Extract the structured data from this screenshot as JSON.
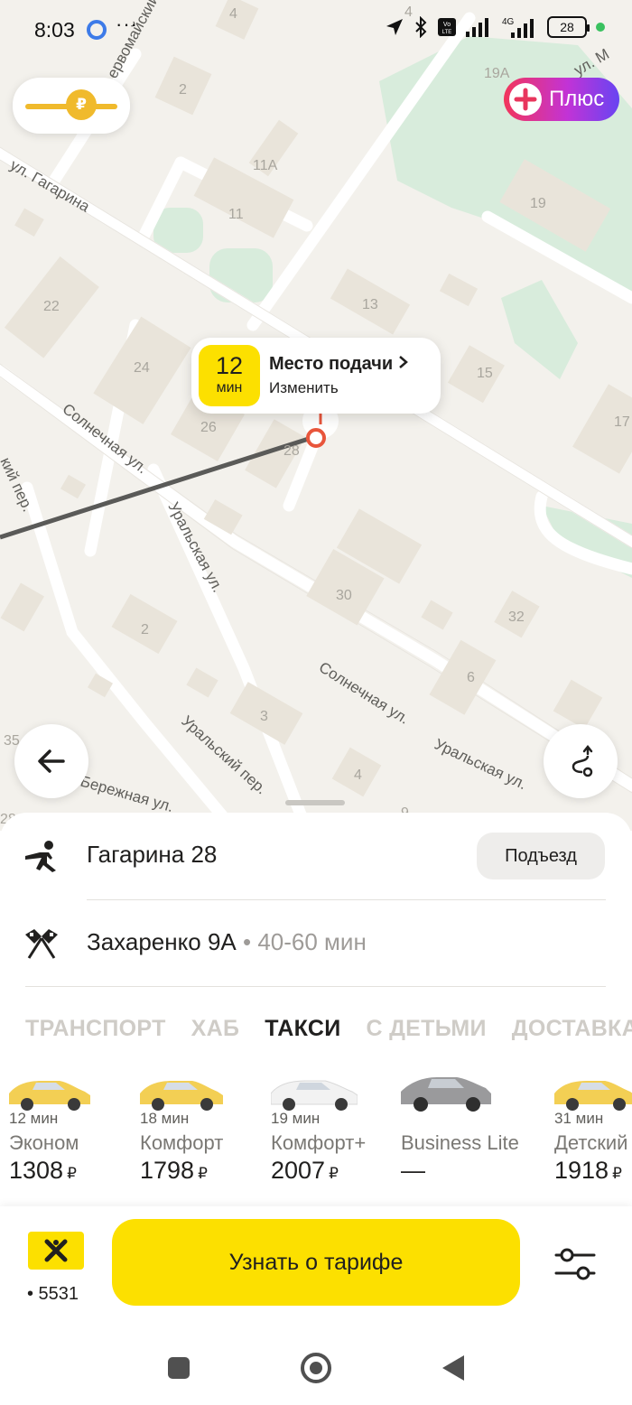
{
  "status_bar": {
    "time": "8:03",
    "more": "···",
    "battery": "28",
    "volte_label": "Vo LTE",
    "net_label": "4G"
  },
  "map": {
    "streets": [
      "ул. Гагарина",
      "Солнечная ул.",
      "Уральская ул.",
      "Солнечная ул.",
      "Уральская ул.",
      "Уральский пер.",
      "Бережная ул.",
      "кий пер.",
      "ервомайский",
      "ул. М"
    ],
    "house_numbers": [
      "4",
      "4",
      "2",
      "19А",
      "11А",
      "11",
      "19",
      "22",
      "13",
      "24",
      "15",
      "17",
      "26",
      "28",
      "30",
      "2",
      "32",
      "6",
      "3",
      "35",
      "4",
      "28",
      "9"
    ]
  },
  "surge": {
    "icon": "ruble-lightning-icon"
  },
  "plus": {
    "label": "Плюс"
  },
  "pickup_bubble": {
    "eta_value": "12",
    "eta_unit": "мин",
    "title": "Место подачи",
    "subtitle": "Изменить"
  },
  "route": {
    "from": "Гагарина 28",
    "entrance_button": "Подъезд",
    "to": "Захаренко 9А",
    "eta_separator": " • ",
    "eta": "40-60 мин"
  },
  "tabs": [
    {
      "label": "ТРАНСПОРТ",
      "active": false
    },
    {
      "label": "ХАБ",
      "active": false
    },
    {
      "label": "ТАКСИ",
      "active": true
    },
    {
      "label": "С ДЕТЬМИ",
      "active": false
    },
    {
      "label": "ДОСТАВКА",
      "active": false
    }
  ],
  "tariffs": [
    {
      "time": "12 мин",
      "name": "Эконом",
      "price": "1308",
      "currency": "₽",
      "car_color": "#f3cf54"
    },
    {
      "time": "18 мин",
      "name": "Комфорт",
      "price": "1798",
      "currency": "₽",
      "car_color": "#f3cf54"
    },
    {
      "time": "19 мин",
      "name": "Комфорт+",
      "price": "2007",
      "currency": "₽",
      "car_color": "#f2f2f2"
    },
    {
      "time": "",
      "name": "Business Lite",
      "price": "—",
      "currency": "",
      "car_color": "#9a9a9c"
    },
    {
      "time": "31 мин",
      "name": "Детский",
      "price": "1918",
      "currency": "₽",
      "car_color": "#f3cf54"
    }
  ],
  "payment": {
    "card_number": "• 5531"
  },
  "order_button": {
    "label": "Узнать о тарифе"
  },
  "colors": {
    "accent_yellow": "#fce000",
    "surge_orange": "#f0ba2c",
    "pin_red": "#e8553b"
  }
}
